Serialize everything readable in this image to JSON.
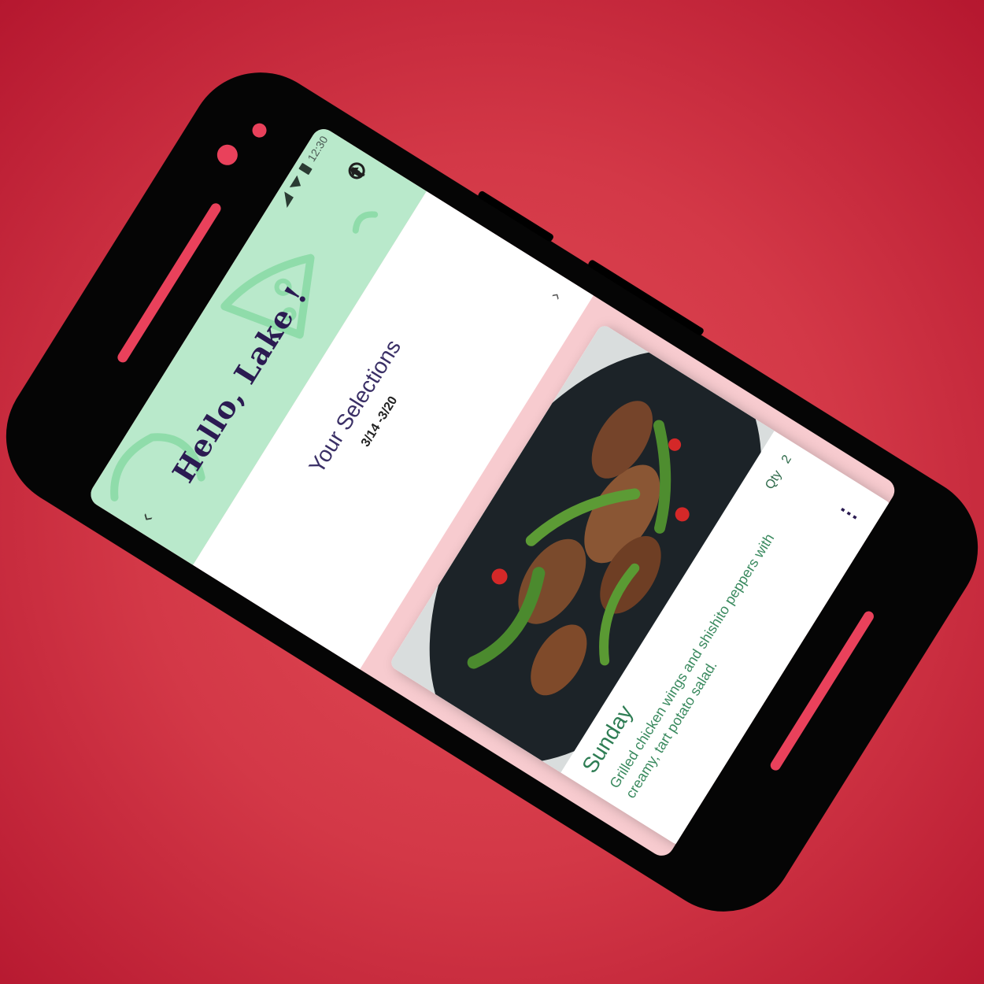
{
  "status_bar": {
    "time": "12:30"
  },
  "header": {
    "greeting": "Hello, Lake !",
    "back_icon": "chevron-left-icon",
    "share_icon": "share-icon",
    "account_icon": "account-icon",
    "menu_icon": "more-vertical-icon",
    "menu_glyph": "⋮",
    "back_glyph": "‹"
  },
  "selections": {
    "title": "Your Selections",
    "date_range": "3/14 -3/20",
    "next_glyph": "›"
  },
  "meal_cards": [
    {
      "day": "Sunday",
      "description": "Grilled chicken wings and shishito peppers with creamy, tart potato salad.",
      "qty_label": "Qty",
      "qty_value": "2",
      "menu_glyph": "⋮"
    }
  ],
  "colors": {
    "background": "#d33847",
    "header_green": "#b9e9cb",
    "title_purple": "#2b1b52",
    "card_green_text": "#2e7d54",
    "screen_pink": "#f7cbcf"
  }
}
